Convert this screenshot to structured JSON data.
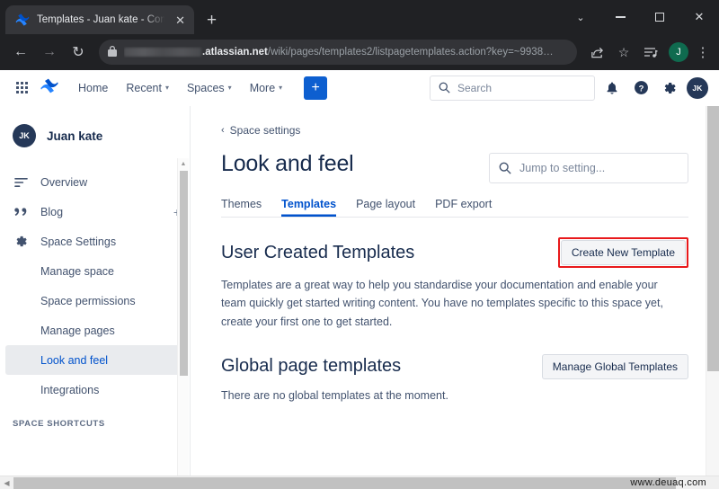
{
  "browser": {
    "tab": {
      "title": "Templates - Juan kate - Confluen",
      "favicon": "confluence-icon",
      "close": "✕"
    },
    "new_tab_label": "+",
    "window_controls": {
      "chevron": "⌄",
      "minimize": "minimize-icon",
      "maximize": "maximize-icon",
      "close": "✕"
    },
    "nav": {
      "back": "←",
      "forward": "→",
      "reload": "↻"
    },
    "url": {
      "lock": "lock-icon",
      "domain": ".atlassian.net",
      "path": "/wiki/pages/templates2/listpagetemplates.action?key=~9938…"
    },
    "toolbar": {
      "share": "share-icon",
      "bookmark": "☆",
      "reading_list": "reading-list-icon",
      "profile_initial": "J",
      "menu": "⋮"
    }
  },
  "appnav": {
    "apps_label": "app-switcher",
    "logo_label": "confluence-logo",
    "items": [
      {
        "label": "Home",
        "caret": false
      },
      {
        "label": "Recent",
        "caret": true
      },
      {
        "label": "Spaces",
        "caret": true
      },
      {
        "label": "More",
        "caret": true
      }
    ],
    "create_label": "+",
    "search": {
      "placeholder": "Search",
      "icon": "search-icon"
    },
    "icons": {
      "notifications": "bell-icon",
      "help": "help-icon",
      "settings": "gear-icon"
    },
    "avatar_initials": "JK"
  },
  "sidebar": {
    "space": {
      "initials": "JK",
      "name": "Juan kate"
    },
    "items": [
      {
        "label": "Overview",
        "icon": "overview-icon",
        "sub": false,
        "active": false,
        "plus": false
      },
      {
        "label": "Blog",
        "icon": "quote-icon",
        "sub": false,
        "active": false,
        "plus": true
      },
      {
        "label": "Space Settings",
        "icon": "gear-icon",
        "sub": false,
        "active": false,
        "plus": false
      },
      {
        "label": "Manage space",
        "icon": "",
        "sub": true,
        "active": false,
        "plus": false
      },
      {
        "label": "Space permissions",
        "icon": "",
        "sub": true,
        "active": false,
        "plus": false
      },
      {
        "label": "Manage pages",
        "icon": "",
        "sub": true,
        "active": false,
        "plus": false
      },
      {
        "label": "Look and feel",
        "icon": "",
        "sub": true,
        "active": true,
        "plus": false
      },
      {
        "label": "Integrations",
        "icon": "",
        "sub": true,
        "active": false,
        "plus": false
      }
    ],
    "shortcuts_label": "SPACE SHORTCUTS",
    "plus_label": "+"
  },
  "main": {
    "breadcrumb": {
      "chevron": "‹",
      "label": "Space settings"
    },
    "page_title": "Look and feel",
    "jump_search": {
      "placeholder": "Jump to setting...",
      "icon": "search-icon"
    },
    "tabs": [
      {
        "label": "Themes",
        "selected": false
      },
      {
        "label": "Templates",
        "selected": true
      },
      {
        "label": "Page layout",
        "selected": false
      },
      {
        "label": "PDF export",
        "selected": false
      }
    ],
    "user_templates": {
      "title": "User Created Templates",
      "button": "Create New Template",
      "description": "Templates are a great way to help you standardise your documentation and enable your team quickly get started writing content. You have no templates specific to this space yet, create your first one to get started."
    },
    "global_templates": {
      "title": "Global page templates",
      "button": "Manage Global Templates",
      "description": "There are no global templates at the moment."
    }
  },
  "watermark": "www.deuaq.com",
  "colors": {
    "accent_blue": "#0052cc",
    "create_button": "#0d5fd0",
    "highlight_red": "#e8191b",
    "chrome_dark": "#202124",
    "text_primary": "#172b4d",
    "text_secondary": "#42526e"
  }
}
